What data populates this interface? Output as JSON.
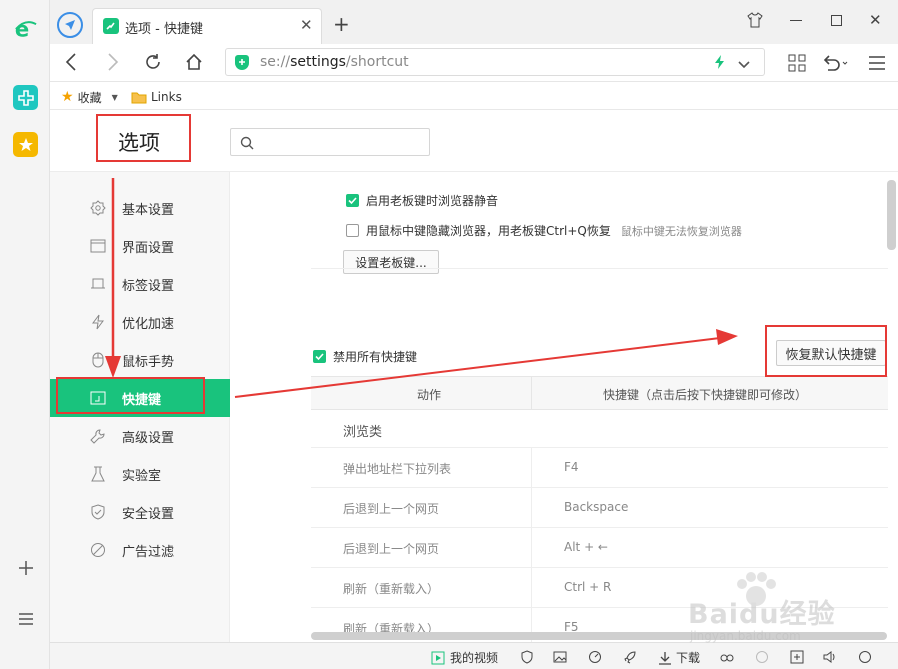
{
  "tab": {
    "title": "选项 - 快捷键"
  },
  "address": {
    "scheme": "se://",
    "host": "settings",
    "path": "/shortcut"
  },
  "bookmarks": {
    "favorites": "收藏",
    "links": "Links"
  },
  "header": {
    "title": "选项",
    "search_placeholder": ""
  },
  "sidebar": {
    "items": [
      {
        "label": "基本设置",
        "icon": "gear-icon"
      },
      {
        "label": "界面设置",
        "icon": "window-icon"
      },
      {
        "label": "标签设置",
        "icon": "tab-icon"
      },
      {
        "label": "优化加速",
        "icon": "lightning-icon"
      },
      {
        "label": "鼠标手势",
        "icon": "mouse-icon"
      },
      {
        "label": "快捷键",
        "icon": "keyboard-icon"
      },
      {
        "label": "高级设置",
        "icon": "wrench-icon"
      },
      {
        "label": "实验室",
        "icon": "flask-icon"
      },
      {
        "label": "安全设置",
        "icon": "shield-icon"
      },
      {
        "label": "广告过滤",
        "icon": "block-icon"
      }
    ]
  },
  "content": {
    "boss_mute_label": "启用老板键时浏览器静音",
    "boss_mute_checked": true,
    "middle_hide_label": "用鼠标中键隐藏浏览器，用老板键Ctrl+Q恢复",
    "middle_hide_hint": "鼠标中键无法恢复浏览器",
    "middle_hide_checked": false,
    "set_boss_key_button": "设置老板键...",
    "disable_all_label": "禁用所有快捷键",
    "disable_all_checked": true,
    "restore_default_button": "恢复默认快捷键",
    "table": {
      "col_action": "动作",
      "col_shortcut": "快捷键（点击后按下快捷键即可修改）",
      "group": "浏览类",
      "rows": [
        {
          "action": "弹出地址栏下拉列表",
          "key": "F4"
        },
        {
          "action": "后退到上一个网页",
          "key": "Backspace"
        },
        {
          "action": "后退到上一个网页",
          "key": "Alt + ←"
        },
        {
          "action": "刷新（重新载入）",
          "key": "Ctrl + R"
        },
        {
          "action": "刷新（重新载入）",
          "key": "F5"
        }
      ]
    }
  },
  "statusbar": {
    "video": "我的视频",
    "download": "下载"
  },
  "watermark": {
    "brand": "Baidu经验",
    "url": "jingyan.baidu.com"
  },
  "colors": {
    "accent": "#19c37d",
    "annotation": "#e53935"
  }
}
